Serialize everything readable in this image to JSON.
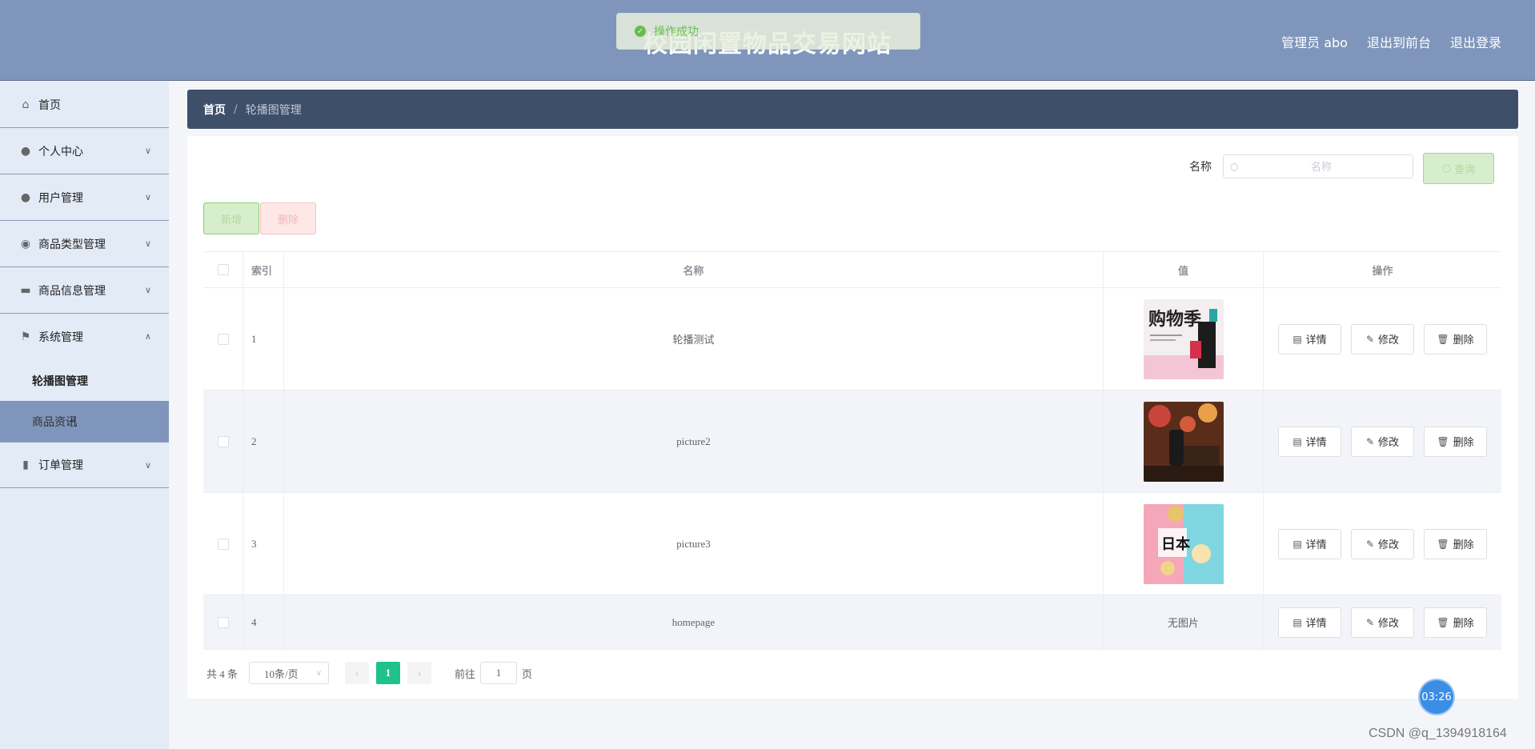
{
  "header": {
    "title": "校园闲置物品交易网站",
    "toast": "操作成功",
    "admin_label": "管理员 abo",
    "to_front": "退出到前台",
    "logout": "退出登录"
  },
  "sidebar": {
    "items": [
      {
        "label": "首页",
        "icon": "home-icon"
      },
      {
        "label": "个人中心",
        "icon": "user-icon"
      },
      {
        "label": "用户管理",
        "icon": "user-icon"
      },
      {
        "label": "商品类型管理",
        "icon": "location-icon"
      },
      {
        "label": "商品信息管理",
        "icon": "ticket-icon"
      },
      {
        "label": "系统管理",
        "icon": "flag-icon"
      },
      {
        "label": "订单管理",
        "icon": "chart-icon"
      }
    ],
    "subitems": {
      "banner": "轮播图管理",
      "goods_info": "商品资讯"
    }
  },
  "breadcrumb": {
    "home": "首页",
    "sep": "/",
    "current": "轮播图管理"
  },
  "search": {
    "label": "名称",
    "placeholder": "名称",
    "button": "查询"
  },
  "actions": {
    "add": "新增",
    "delete": "删除"
  },
  "table": {
    "headers": {
      "index": "索引",
      "name": "名称",
      "value": "值",
      "ops": "操作"
    },
    "rows": [
      {
        "index": "1",
        "name": "轮播测试",
        "value_image": "banner-image-1"
      },
      {
        "index": "2",
        "name": "picture2",
        "value_image": "banner-image-2"
      },
      {
        "index": "3",
        "name": "picture3",
        "value_image": "banner-image-3"
      },
      {
        "index": "4",
        "name": "homepage",
        "value_text": "无图片"
      }
    ],
    "op_labels": {
      "detail": "详情",
      "edit": "修改",
      "remove": "删除"
    }
  },
  "pagination": {
    "total": "共 4 条",
    "page_size": "10条/页",
    "current_page": "1",
    "goto_prefix": "前往",
    "goto_value": "1",
    "goto_suffix": "页"
  },
  "timer": "03:26",
  "watermark": "CSDN @q_1394918164"
}
